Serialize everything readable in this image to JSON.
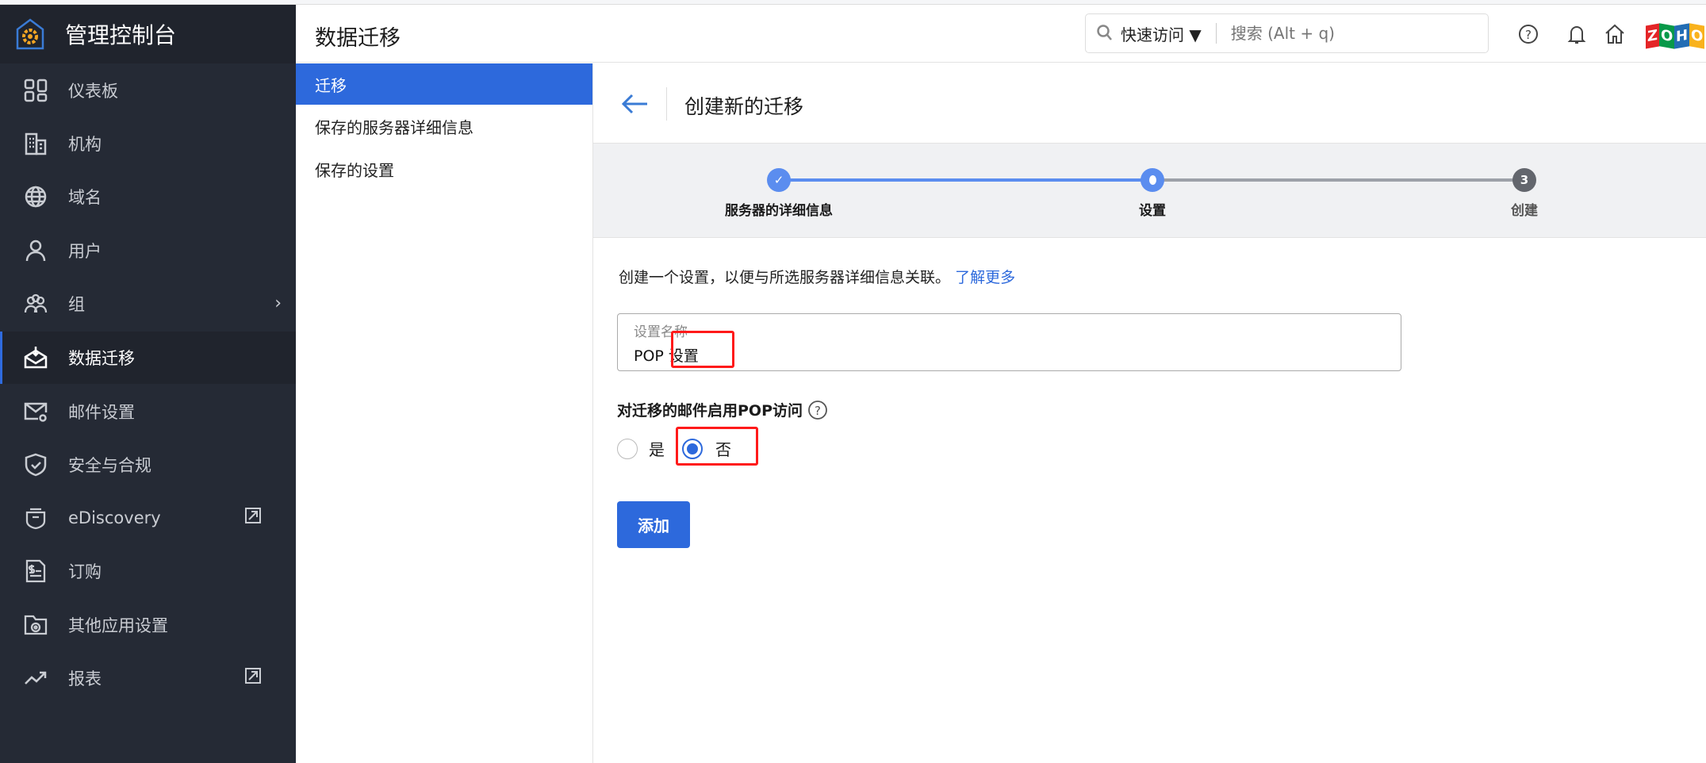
{
  "app": {
    "title": "管理控制台"
  },
  "sidebar": {
    "items": [
      {
        "label": "仪表板",
        "icon": "dashboard-icon"
      },
      {
        "label": "机构",
        "icon": "building-icon"
      },
      {
        "label": "域名",
        "icon": "globe-icon"
      },
      {
        "label": "用户",
        "icon": "user-icon"
      },
      {
        "label": "组",
        "icon": "group-icon"
      },
      {
        "label": "数据迁移",
        "icon": "migration-icon",
        "active": true
      },
      {
        "label": "邮件设置",
        "icon": "mail-settings-icon"
      },
      {
        "label": "安全与合规",
        "icon": "shield-icon"
      },
      {
        "label": "eDiscovery",
        "icon": "ediscovery-icon"
      },
      {
        "label": "订购",
        "icon": "billing-icon"
      },
      {
        "label": "其他应用设置",
        "icon": "folder-gear-icon"
      },
      {
        "label": "报表",
        "icon": "trend-icon"
      }
    ]
  },
  "header": {
    "title": "数据迁移",
    "quick_access": "快速访问",
    "search_placeholder": "搜索 (Alt + q)"
  },
  "subnav": {
    "items": [
      "迁移",
      "保存的服务器详细信息",
      "保存的设置"
    ]
  },
  "main": {
    "title": "创建新的迁移",
    "steps": [
      {
        "label": "服务器的详细信息",
        "state": "done"
      },
      {
        "label": "设置",
        "state": "current"
      },
      {
        "label": "创建",
        "state": "pending",
        "number": "3"
      }
    ],
    "description": "创建一个设置，以便与所选服务器详细信息关联。",
    "learn_more": "了解更多",
    "field_label": "设置名称",
    "field_value": "POP 设置",
    "pop_label": "对迁移的邮件启用POP访问",
    "options": [
      "是",
      "否"
    ],
    "selected": "否",
    "add_button": "添加"
  },
  "colors": {
    "accent": "#2d69dc",
    "sidebar": "#252a35",
    "highlight": "#ff1a1a"
  }
}
